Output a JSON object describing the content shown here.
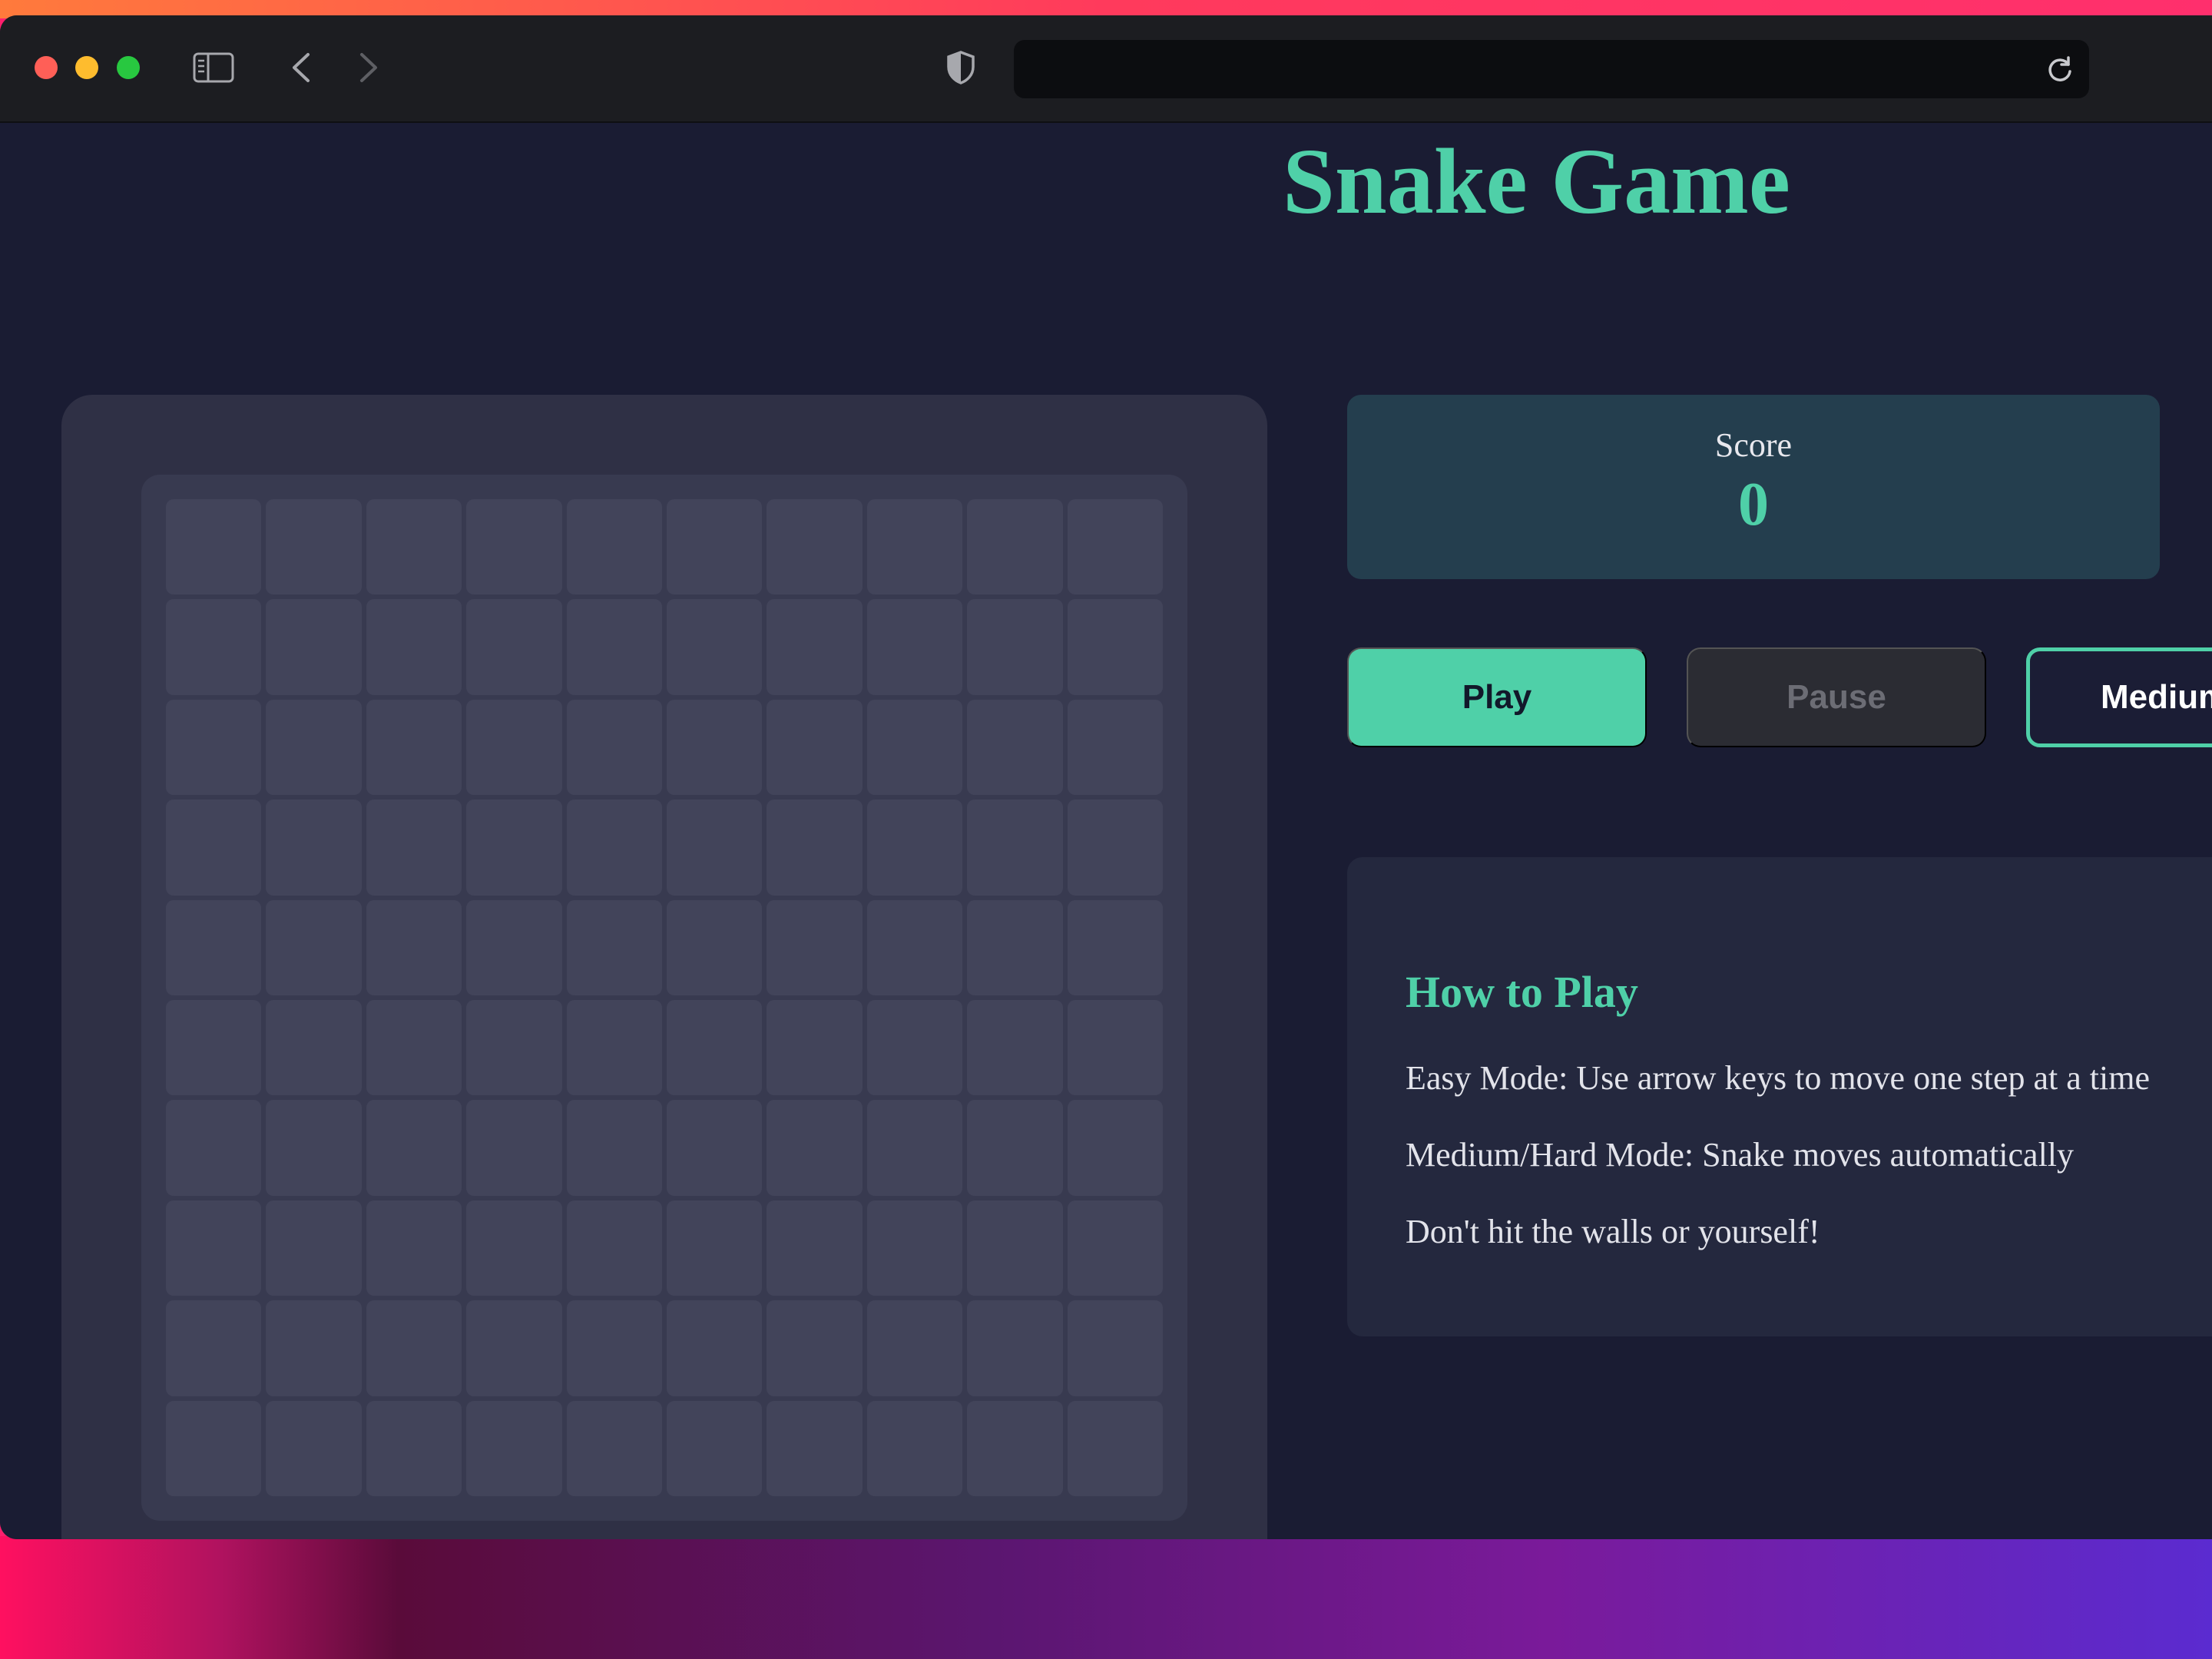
{
  "colors": {
    "accent": "#4fd0a8",
    "page_bg": "#1a1c33",
    "board_bg": "#2f3045",
    "cell": "#42445a",
    "score_bg": "#243e4e",
    "pause_bg": "#2b2c33"
  },
  "browser": {
    "icons": [
      "sidebar-icon",
      "back-icon",
      "forward-icon",
      "shield-icon",
      "reload-icon"
    ]
  },
  "page": {
    "title": "Snake Game"
  },
  "board": {
    "rows": 10,
    "cols": 10
  },
  "score": {
    "label": "Score",
    "value": "0"
  },
  "controls": {
    "play_label": "Play",
    "pause_label": "Pause",
    "difficulty_label": "Medium"
  },
  "how_to_play": {
    "title": "How to Play",
    "lines": [
      "Easy Mode: Use arrow keys to move one step at a time",
      "Medium/Hard Mode: Snake moves automatically",
      "Don't hit the walls or yourself!"
    ]
  }
}
